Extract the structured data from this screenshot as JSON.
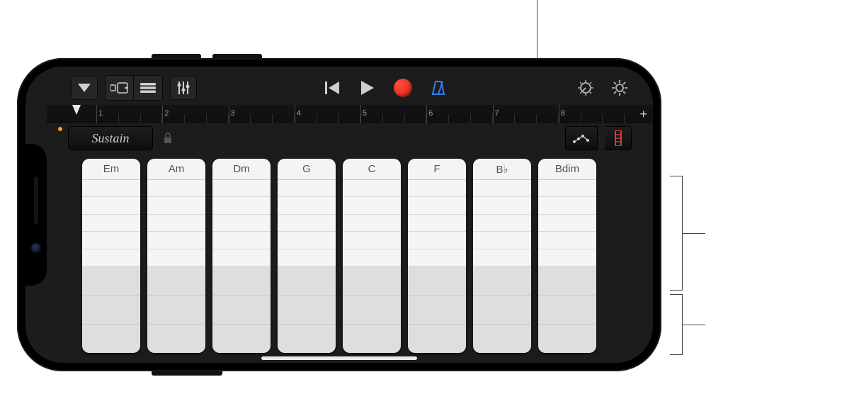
{
  "toolbar": {
    "menu": "menu",
    "browser": "loop-browser",
    "tracklist": "track-list",
    "mixer": "mixer-controls",
    "gotostart": "go-to-beginning",
    "play": "play",
    "record": "record",
    "metronome": "metronome",
    "masterfx": "master-effects",
    "settings": "settings"
  },
  "ruler": {
    "bars": [
      "1",
      "2",
      "3",
      "4",
      "5",
      "6",
      "7",
      "8"
    ],
    "plus": "+"
  },
  "sustain": {
    "label": "Sustain"
  },
  "chords": [
    "Em",
    "Am",
    "Dm",
    "G",
    "C",
    "F",
    "B♭",
    "Bdim"
  ],
  "strip": {
    "topRows": 5,
    "bottomRows": 3
  },
  "icons": {
    "arp": "arpeggiator",
    "view": "chord-strips-view"
  }
}
